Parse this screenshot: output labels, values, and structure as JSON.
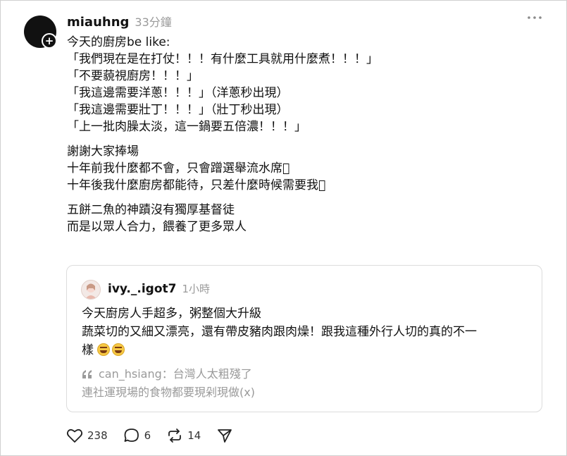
{
  "post": {
    "username": "miauhng",
    "timestamp": "33分鐘",
    "lines_p1": [
      "今天的廚房be like:",
      "「我們現在是在打仗！！！有什麼工具就用什麼煮！！！」",
      "「不要藐視廚房！！！」",
      "「我這邊需要洋蔥！！！」（洋蔥秒出現）",
      "「我這邊需要壯丁！！！」（壯丁秒出現）",
      "「上一批肉臊太淡，這一鍋要五倍濃！！！」"
    ],
    "lines_p2": [
      "謝謝大家捧場",
      "十年前我什麼都不會，只會蹭選舉流水席􀀀",
      "十年後我什麼廚房都能待，只差什麼時候需要我􀀀"
    ],
    "lines_p3": [
      "五餅二魚的神蹟沒有獨厚基督徒",
      "而是以眾人合力，餵養了更多眾人"
    ]
  },
  "quoted": {
    "username": "ivy._.igot7",
    "timestamp": "1小時",
    "line1": "今天廚房人手超多，粥整個大升級",
    "line2": "蔬菜切的又細又漂亮，還有帶皮豬肉跟肉燥！跟我這種外行人切的真的不一",
    "line3": "樣",
    "reply_head": "can_hsiang：台灣人太粗殘了",
    "reply_body": "連社運現場的食物都要現剁現做(x)"
  },
  "actions": {
    "likes": "238",
    "comments": "6",
    "reposts": "14"
  },
  "icons": {
    "more": "more-horizontal-icon",
    "like": "heart-icon",
    "comment": "comment-icon",
    "repost": "repost-icon",
    "share": "send-icon",
    "quote": "quote-mark-icon"
  },
  "colors": {
    "text": "#111111",
    "muted": "#9a9a9a",
    "border": "#dcdcdc",
    "avatar": "#111111"
  }
}
